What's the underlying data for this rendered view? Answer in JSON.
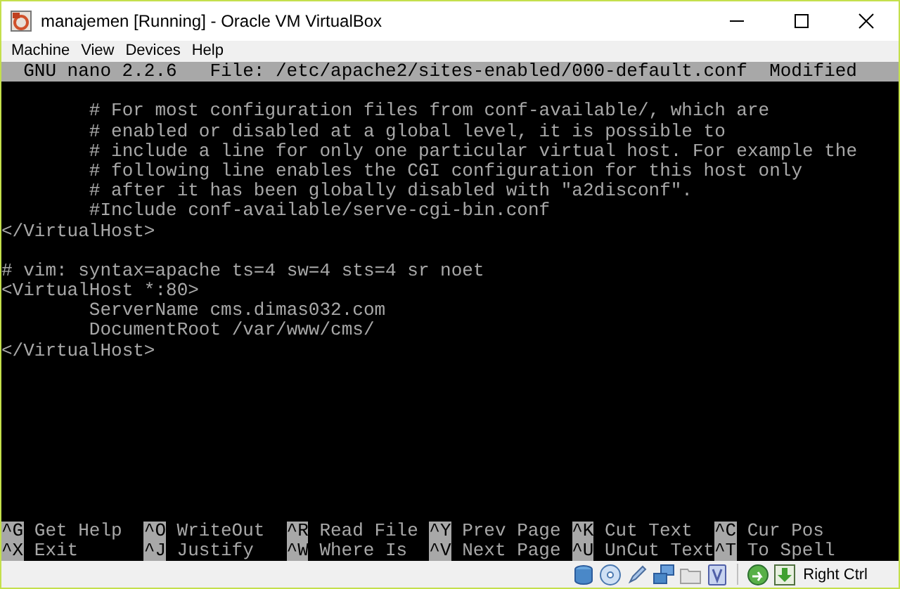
{
  "window": {
    "title": "manajemen [Running] - Oracle VM VirtualBox"
  },
  "menu": [
    "Machine",
    "View",
    "Devices",
    "Help"
  ],
  "nano": {
    "header": {
      "version": "GNU nano 2.2.6",
      "file": "File: /etc/apache2/sites-enabled/000-default.conf",
      "state": "Modified"
    },
    "blocks": [
      [
        "        # For most configuration files from conf-available/, which are",
        "        # enabled or disabled at a global level, it is possible to",
        "        # include a line for only one particular virtual host. For example the",
        "        # following line enables the CGI configuration for this host only",
        "        # after it has been globally disabled with \"a2disconf\".",
        "        #Include conf-available/serve-cgi-bin.conf",
        "</VirtualHost>"
      ],
      [
        "# vim: syntax=apache ts=4 sw=4 sts=4 sr noet",
        "<VirtualHost *:80>",
        "        ServerName cms.dimas032.com",
        "        DocumentRoot /var/www/cms/",
        "</VirtualHost>"
      ]
    ],
    "shortcuts": [
      [
        {
          "key": "^G",
          "label": "Get Help"
        },
        {
          "key": "^O",
          "label": "WriteOut"
        },
        {
          "key": "^R",
          "label": "Read File"
        },
        {
          "key": "^Y",
          "label": "Prev Page"
        },
        {
          "key": "^K",
          "label": "Cut Text"
        },
        {
          "key": "^C",
          "label": "Cur Pos"
        }
      ],
      [
        {
          "key": "^X",
          "label": "Exit"
        },
        {
          "key": "^J",
          "label": "Justify"
        },
        {
          "key": "^W",
          "label": "Where Is"
        },
        {
          "key": "^V",
          "label": "Next Page"
        },
        {
          "key": "^U",
          "label": "UnCut Text"
        },
        {
          "key": "^T",
          "label": "To Spell"
        }
      ]
    ]
  },
  "status_bar": {
    "host_key": "Right Ctrl"
  }
}
